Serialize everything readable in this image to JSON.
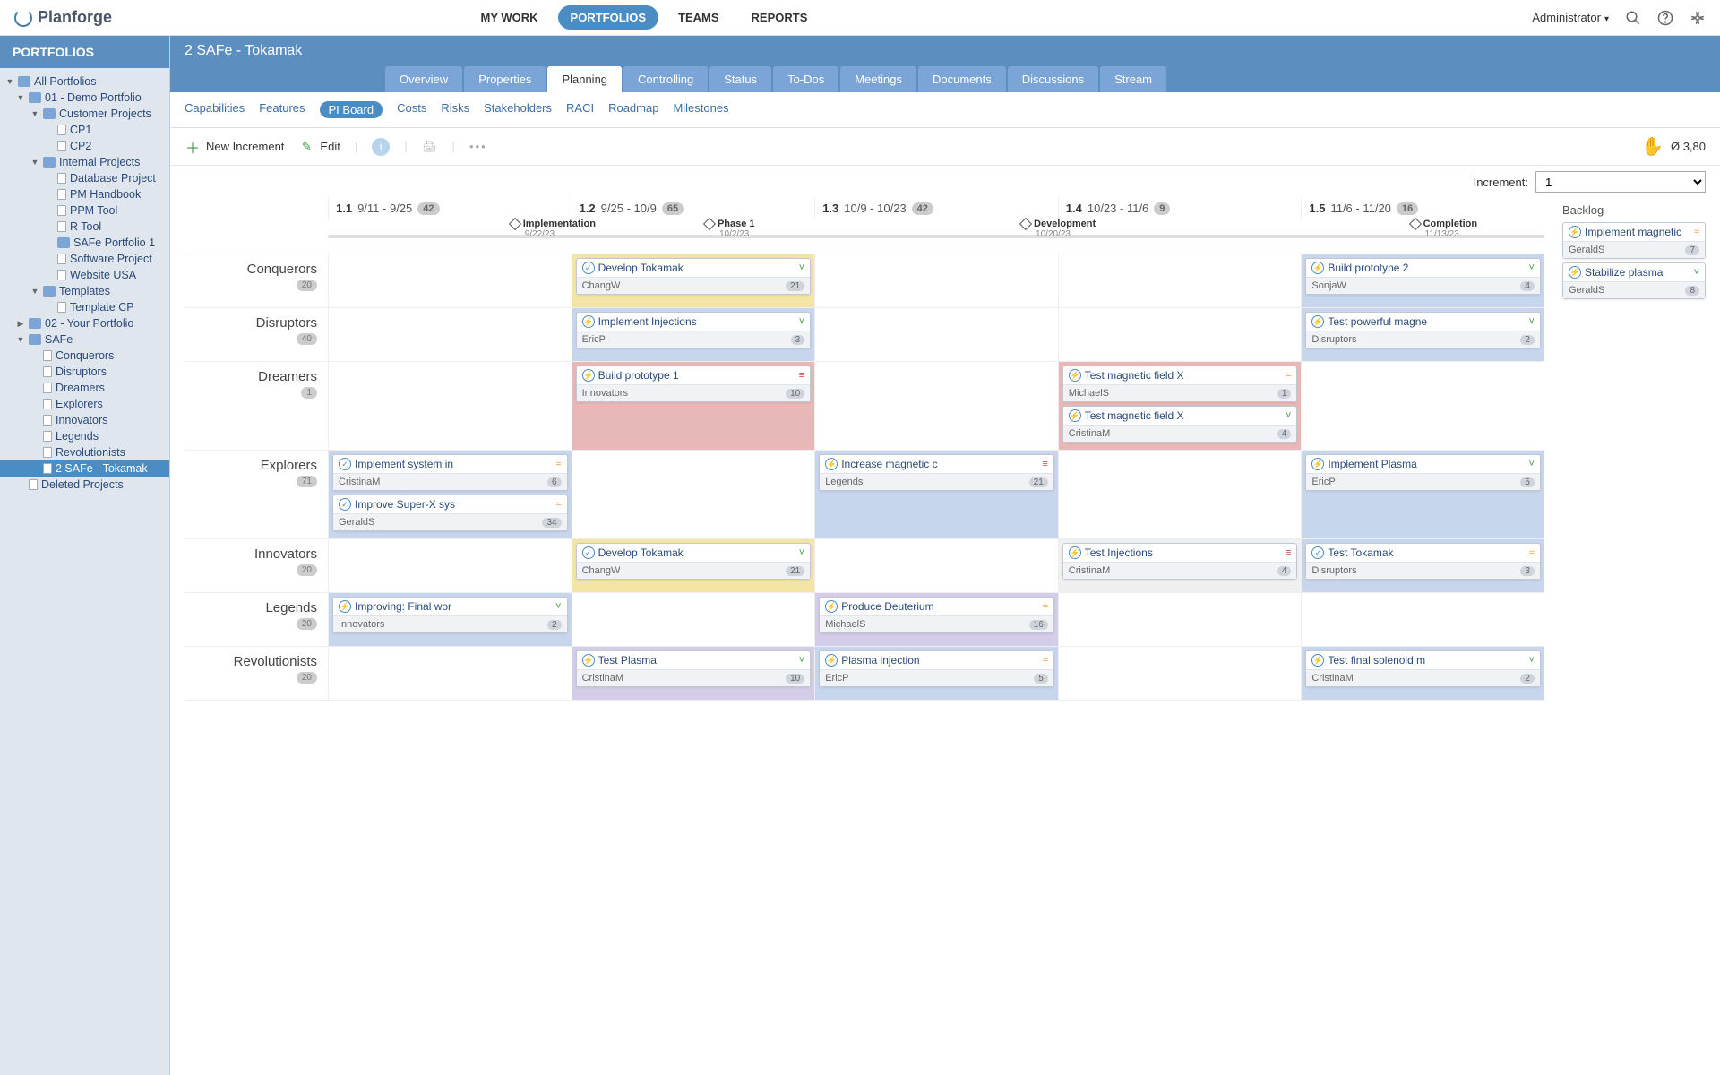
{
  "app": {
    "name": "Planforge"
  },
  "topnav": [
    {
      "label": "MY WORK"
    },
    {
      "label": "PORTFOLIOS",
      "active": true
    },
    {
      "label": "TEAMS"
    },
    {
      "label": "REPORTS"
    }
  ],
  "user": {
    "name": "Administrator"
  },
  "sidebar": {
    "title": "PORTFOLIOS",
    "tree": {
      "root": "All Portfolios",
      "demo": "01 - Demo Portfolio",
      "cust": "Customer Projects",
      "cp1": "CP1",
      "cp2": "CP2",
      "int": "Internal Projects",
      "db": "Database Project",
      "pm": "PM Handbook",
      "ppm": "PPM Tool",
      "r": "R Tool",
      "safe1": "SAFe Portfolio 1",
      "sw": "Software Project",
      "web": "Website USA",
      "tmpl": "Templates",
      "tcp": "Template CP",
      "your": "02 - Your Portfolio",
      "safe": "SAFe",
      "t1": "Conquerors",
      "t2": "Disruptors",
      "t3": "Dreamers",
      "t4": "Explorers",
      "t5": "Innovators",
      "t6": "Legends",
      "t7": "Revolutionists",
      "sel": "2 SAFe - Tokamak",
      "del": "Deleted Projects"
    }
  },
  "page": {
    "title": "2 SAFe - Tokamak"
  },
  "tabs1": [
    "Overview",
    "Properties",
    "Planning",
    "Controlling",
    "Status",
    "To-Dos",
    "Meetings",
    "Documents",
    "Discussions",
    "Stream"
  ],
  "tabs1_active": 2,
  "tabs2": [
    "Capabilities",
    "Features",
    "PI Board",
    "Costs",
    "Risks",
    "Stakeholders",
    "RACI",
    "Roadmap",
    "Milestones"
  ],
  "tabs2_active": 2,
  "toolbar": {
    "new": "New Increment",
    "edit": "Edit",
    "avg": "Ø 3,80"
  },
  "increment": {
    "label": "Increment:",
    "value": "1"
  },
  "sprints": [
    {
      "num": "1.1",
      "dates": "9/11 - 9/25",
      "pts": "42"
    },
    {
      "num": "1.2",
      "dates": "9/25 - 10/9",
      "pts": "65"
    },
    {
      "num": "1.3",
      "dates": "10/9 - 10/23",
      "pts": "42"
    },
    {
      "num": "1.4",
      "dates": "10/23 - 11/6",
      "pts": "9"
    },
    {
      "num": "1.5",
      "dates": "11/6 - 11/20",
      "pts": "16"
    }
  ],
  "milestones": [
    {
      "label": "Implementation",
      "date": "9/22/23",
      "pos": 15
    },
    {
      "label": "Phase 1",
      "date": "10/2/23",
      "pos": 31
    },
    {
      "label": "Development",
      "date": "10/20/23",
      "pos": 57
    },
    {
      "label": "Completion",
      "date": "11/13/23",
      "pos": 89
    }
  ],
  "teams": [
    {
      "name": "Conquerors",
      "pts": "20",
      "rows": [
        [
          null,
          {
            "c": "yellow",
            "items": [
              {
                "t": "Develop Tokamak",
                "o": "ChangW",
                "p": "21",
                "pr": "low",
                "i": "chk"
              }
            ]
          },
          null,
          null,
          {
            "c": "blue",
            "items": [
              {
                "t": "Build prototype 2",
                "o": "SonjaW",
                "p": "4",
                "pr": "low",
                "i": "bolt"
              }
            ]
          }
        ]
      ]
    },
    {
      "name": "Disruptors",
      "pts": "40",
      "rows": [
        [
          null,
          {
            "c": "blue",
            "items": [
              {
                "t": "Implement Injections",
                "o": "EricP",
                "p": "3",
                "pr": "low",
                "i": "bolt"
              }
            ]
          },
          null,
          null,
          {
            "c": "blue",
            "items": [
              {
                "t": "Test powerful magne",
                "o": "Disruptors",
                "p": "2",
                "pr": "low",
                "i": "bolt"
              }
            ]
          }
        ]
      ]
    },
    {
      "name": "Dreamers",
      "pts": "1",
      "rows": [
        [
          null,
          {
            "c": "red",
            "items": [
              {
                "t": "Build prototype 1",
                "o": "Innovators",
                "p": "10",
                "pr": "high",
                "i": "bolt"
              }
            ]
          },
          null,
          {
            "c": "red",
            "items": [
              {
                "t": "Test magnetic field X",
                "o": "MichaelS",
                "p": "1",
                "pr": "med",
                "i": "bolt"
              },
              {
                "t": "Test magnetic field X",
                "o": "CristinaM",
                "p": "4",
                "pr": "low",
                "i": "bolt"
              }
            ]
          },
          null
        ]
      ]
    },
    {
      "name": "Explorers",
      "pts": "71",
      "rows": [
        [
          {
            "c": "blue",
            "items": [
              {
                "t": "Implement system in",
                "o": "CristinaM",
                "p": "6",
                "pr": "med",
                "i": "chk"
              },
              {
                "t": "Improve Super-X sys",
                "o": "GeraldS",
                "p": "34",
                "pr": "med",
                "i": "chk"
              }
            ]
          },
          null,
          {
            "c": "blue",
            "items": [
              {
                "t": "Increase magnetic c",
                "o": "Legends",
                "p": "21",
                "pr": "high",
                "i": "bolt"
              }
            ]
          },
          null,
          {
            "c": "blue",
            "items": [
              {
                "t": "Implement Plasma",
                "o": "EricP",
                "p": "5",
                "pr": "low",
                "i": "bolt"
              }
            ]
          }
        ]
      ]
    },
    {
      "name": "Innovators",
      "pts": "20",
      "rows": [
        [
          null,
          {
            "c": "yellow",
            "items": [
              {
                "t": "Develop Tokamak",
                "o": "ChangW",
                "p": "21",
                "pr": "low",
                "i": "chk"
              }
            ]
          },
          null,
          {
            "c": "gray",
            "items": [
              {
                "t": "Test Injections",
                "o": "CristinaM",
                "p": "4",
                "pr": "high",
                "i": "bolt"
              }
            ]
          },
          {
            "c": "blue",
            "items": [
              {
                "t": "Test Tokamak",
                "o": "Disruptors",
                "p": "3",
                "pr": "med",
                "i": "chk"
              }
            ]
          }
        ]
      ]
    },
    {
      "name": "Legends",
      "pts": "20",
      "rows": [
        [
          {
            "c": "blue",
            "items": [
              {
                "t": "Improving: Final wor",
                "o": "Innovators",
                "p": "2",
                "pr": "low",
                "i": "bolt"
              }
            ]
          },
          null,
          {
            "c": "purple",
            "items": [
              {
                "t": "Produce Deuterium",
                "o": "MichaelS",
                "p": "16",
                "pr": "med",
                "i": "bolt"
              }
            ]
          },
          null,
          null
        ]
      ]
    },
    {
      "name": "Revolutionists",
      "pts": "20",
      "rows": [
        [
          null,
          {
            "c": "purple",
            "items": [
              {
                "t": "Test Plasma",
                "o": "CristinaM",
                "p": "10",
                "pr": "low",
                "i": "bolt"
              }
            ]
          },
          {
            "c": "blue",
            "items": [
              {
                "t": "Plasma injection",
                "o": "EricP",
                "p": "5",
                "pr": "med",
                "i": "bolt"
              }
            ]
          },
          null,
          {
            "c": "blue",
            "items": [
              {
                "t": "Test final solenoid m",
                "o": "CristinaM",
                "p": "2",
                "pr": "low",
                "i": "bolt"
              }
            ]
          }
        ]
      ]
    }
  ],
  "backlog": {
    "title": "Backlog",
    "items": [
      {
        "t": "Implement magnetic",
        "o": "GeraldS",
        "p": "7",
        "pr": "med",
        "i": "bolt"
      },
      {
        "t": "Stabilize plasma",
        "o": "GeraldS",
        "p": "8",
        "pr": "low",
        "i": "bolt"
      }
    ]
  }
}
